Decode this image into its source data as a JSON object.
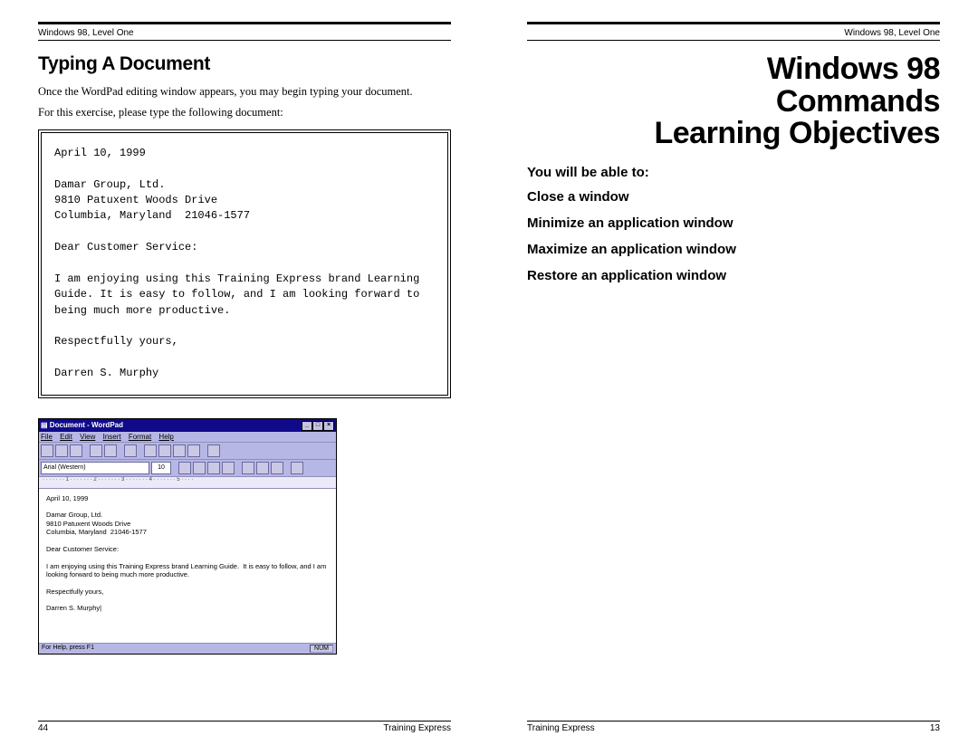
{
  "left": {
    "header": "Windows 98, Level One",
    "title": "Typing A Document",
    "para1": "Once the WordPad editing window appears, you may begin typing your document.",
    "para2": "For this exercise, please type the following document:",
    "letter": "April 10, 1999\n\nDamar Group, Ltd.\n9810 Patuxent Woods Drive\nColumbia, Maryland  21046-1577\n\nDear Customer Service:\n\nI am enjoying using this Training Express brand Learning Guide. It is easy to follow, and I am looking forward to being much more productive.\n\nRespectfully yours,\n\nDarren S. Murphy",
    "wordpad": {
      "title": "Document - WordPad",
      "menus": [
        "File",
        "Edit",
        "View",
        "Insert",
        "Format",
        "Help"
      ],
      "font": "Arial (Western)",
      "size": "10",
      "ruler": "· · · · · · · 1 · · · · · · · 2 · · · · · · · 3 · · · · · · · 4 · · · · · · · 5 · · · ·",
      "doc": "April 10, 1999\n\nDamar Group, Ltd.\n9810 Patuxent Woods Drive\nColumbia, Maryland  21046-1577\n\nDear Customer Service:\n\nI am enjoying using this Training Express brand Learning Guide.  It is easy to follow, and I am looking forward to being much more productive.\n\nRespectfully yours,\n\nDarren S. Murphy|",
      "status_left": "For Help, press F1",
      "status_right": "NUM"
    },
    "footer_left": "44",
    "footer_right": "Training Express"
  },
  "right": {
    "header": "Windows 98, Level One",
    "title_l1": "Windows 98",
    "title_l2": "Commands",
    "title_l3": "Learning Objectives",
    "lead": "You will be able to:",
    "items": [
      "Close a window",
      "Minimize an application window",
      "Maximize an application window",
      "Restore an application window"
    ],
    "footer_left": "Training Express",
    "footer_right": "13"
  }
}
